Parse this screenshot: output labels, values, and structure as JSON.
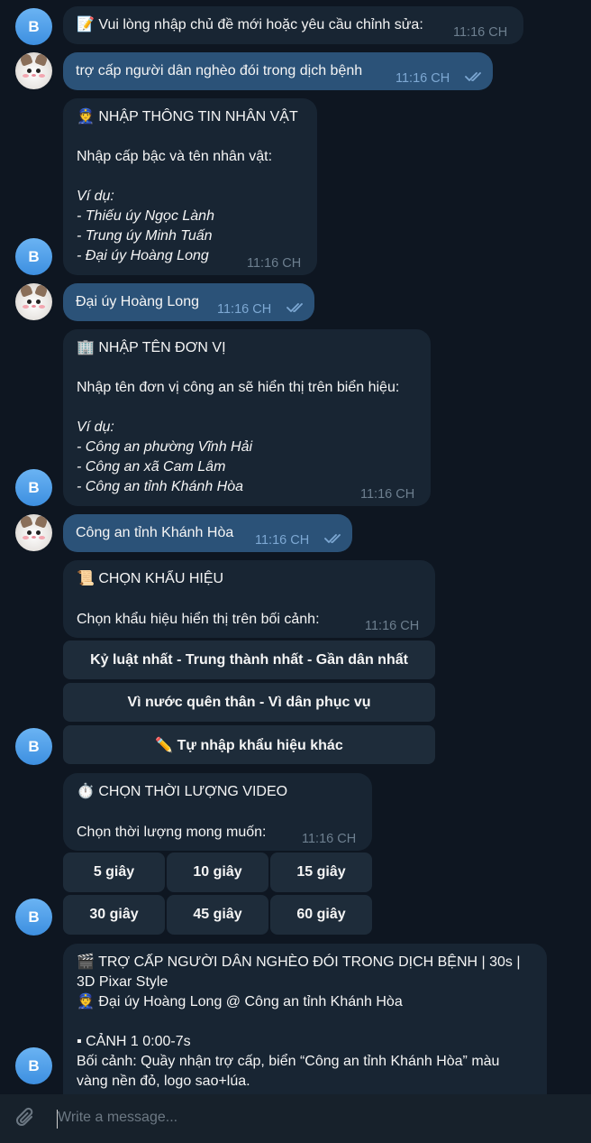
{
  "messages": {
    "m1": {
      "avatar": "B",
      "text": "📝 Vui lòng nhập chủ đề mới hoặc yêu cầu chỉnh sửa:",
      "time": "11:16 CH"
    },
    "m2": {
      "text": "trợ cấp người dân nghèo đói trong dịch bệnh",
      "time": "11:16 CH"
    },
    "m3": {
      "avatar": "B",
      "title": "👮 NHẬP THÔNG TIN NHÂN VẬT",
      "body": "Nhập cấp bậc và tên nhân vật:",
      "example_label": "Ví dụ:",
      "examples": [
        "- Thiếu úy Ngọc Lành",
        "- Trung úy Minh Tuấn",
        "- Đại úy Hoàng Long"
      ],
      "time": "11:16 CH"
    },
    "m4": {
      "text": "Đại úy Hoàng Long",
      "time": "11:16 CH"
    },
    "m5": {
      "avatar": "B",
      "title": "🏢 NHẬP TÊN ĐƠN VỊ",
      "body": "Nhập tên đơn vị công an sẽ hiển thị trên biển hiệu:",
      "example_label": "Ví dụ:",
      "examples": [
        "- Công an phường Vĩnh Hải",
        "- Công an xã Cam Lâm",
        "- Công an tỉnh Khánh Hòa"
      ],
      "time": "11:16 CH"
    },
    "m6": {
      "text": "Công an tỉnh Khánh Hòa",
      "time": "11:16 CH"
    },
    "m7": {
      "avatar": "B",
      "title": "📜 CHỌN KHẨU HIỆU",
      "body": "Chọn khẩu hiệu hiển thị trên bối cảnh:",
      "time": "11:16 CH",
      "buttons": [
        "Kỷ luật nhất - Trung thành nhất - Gần dân nhất",
        "Vì nước quên thân - Vì dân phục vụ",
        "✏️ Tự nhập khẩu hiệu khác"
      ]
    },
    "m8": {
      "avatar": "B",
      "title": "⏱️ CHỌN THỜI LƯỢNG VIDEO",
      "body": "Chọn thời lượng mong muốn:",
      "time": "11:16 CH",
      "buttons": [
        "5 giây",
        "10 giây",
        "15 giây",
        "30 giây",
        "45 giây",
        "60 giây"
      ]
    },
    "m9": {
      "avatar": "B",
      "lines": [
        "🎬 TRỢ CẤP NGƯỜI DÂN NGHÈO ĐÓI TRONG DỊCH BỆNH | 30s |",
        "3D Pixar Style",
        "👮 Đại úy Hoàng Long @ Công an tỉnh Khánh Hòa",
        "",
        "▪ CẢNH 1 0:00-7s",
        "Bối cảnh: Quầy nhận trợ cấp, biển “Công an tỉnh Khánh Hòa” màu",
        "vàng nền đỏ, logo sao+lúa."
      ]
    }
  },
  "composer": {
    "placeholder": "Write a message..."
  },
  "colors": {
    "background": "#0e1621",
    "incoming": "#182533",
    "outgoing": "#2b5278",
    "button": "#1e2c3a",
    "accent": "#6ab3f3"
  },
  "icons": {
    "read_receipt": "double-check-icon",
    "attach": "paperclip-icon"
  }
}
